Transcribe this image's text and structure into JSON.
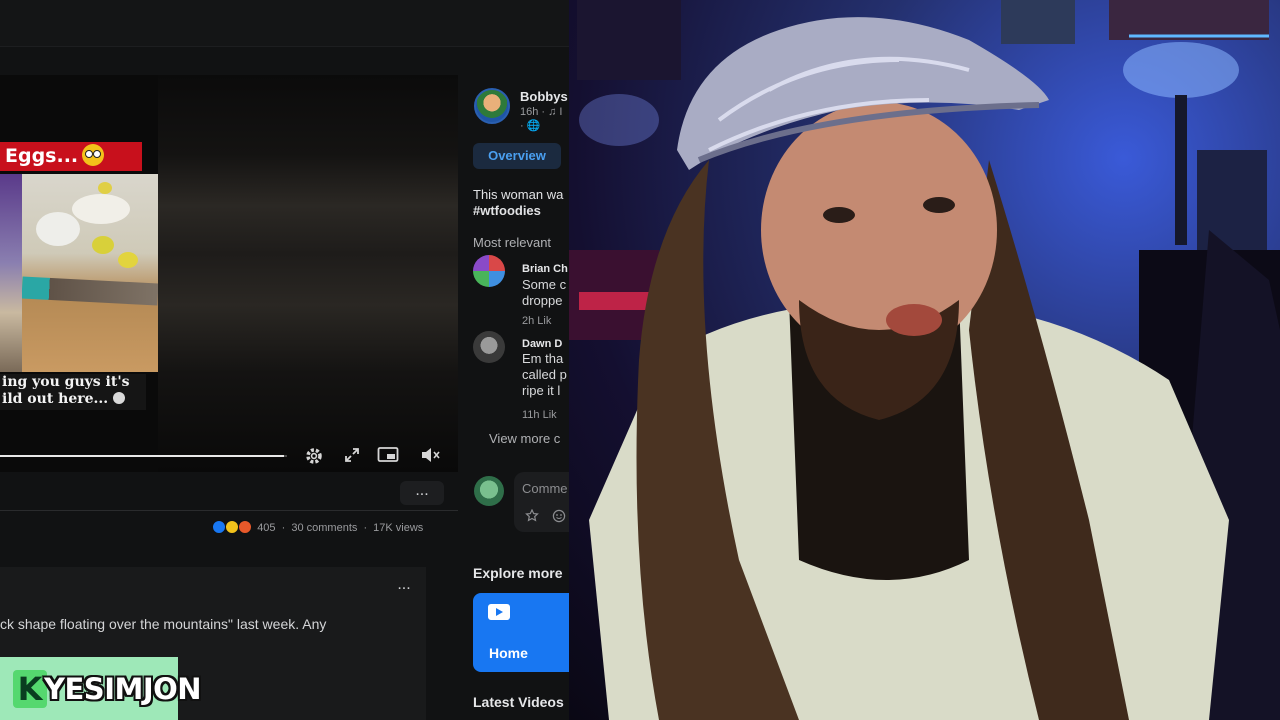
{
  "video": {
    "caption_top": "Eggs...",
    "caption_bottom_line1": "ing you guys it's",
    "caption_bottom_line2": "ild out here...",
    "progress_fraction": 0.99
  },
  "post": {
    "more_label": "...",
    "reaction_count": "405",
    "comments": "30 comments",
    "views": "17K views",
    "separator": "·"
  },
  "post2": {
    "more_label": "...",
    "text": "ck shape floating over the mountains\" last week. Any"
  },
  "side": {
    "author_name": "Bobbys",
    "author_meta": "16h · ♫ I",
    "author_meta2": "· 🌐",
    "tab_overview": "Overview",
    "desc_line1": "This woman wa",
    "desc_line2": "#wtfoodies",
    "most_relevant": "Most relevant",
    "comments": [
      {
        "name": "Brian Ch",
        "lines": [
          "Some c",
          "droppe"
        ],
        "meta": "2h   Lik"
      },
      {
        "name": "Dawn D",
        "lines": [
          "Em tha",
          "called p",
          "ripe it l"
        ],
        "meta": "11h   Lik"
      }
    ],
    "view_more": "View more c",
    "comment_placeholder": "Comme",
    "explore": "Explore more",
    "home_label": "Home",
    "latest": "Latest Videos"
  },
  "logo": {
    "text": "YESIMJON",
    "letter": "K"
  },
  "colors": {
    "accent_blue": "#1877f2",
    "caption_red": "#c8101c",
    "logo_green": "#55d86f"
  },
  "icons": [
    "settings-icon",
    "fullscreen-icon",
    "pip-icon",
    "mute-icon",
    "sticker-icon",
    "emoji-icon",
    "video-icon"
  ]
}
